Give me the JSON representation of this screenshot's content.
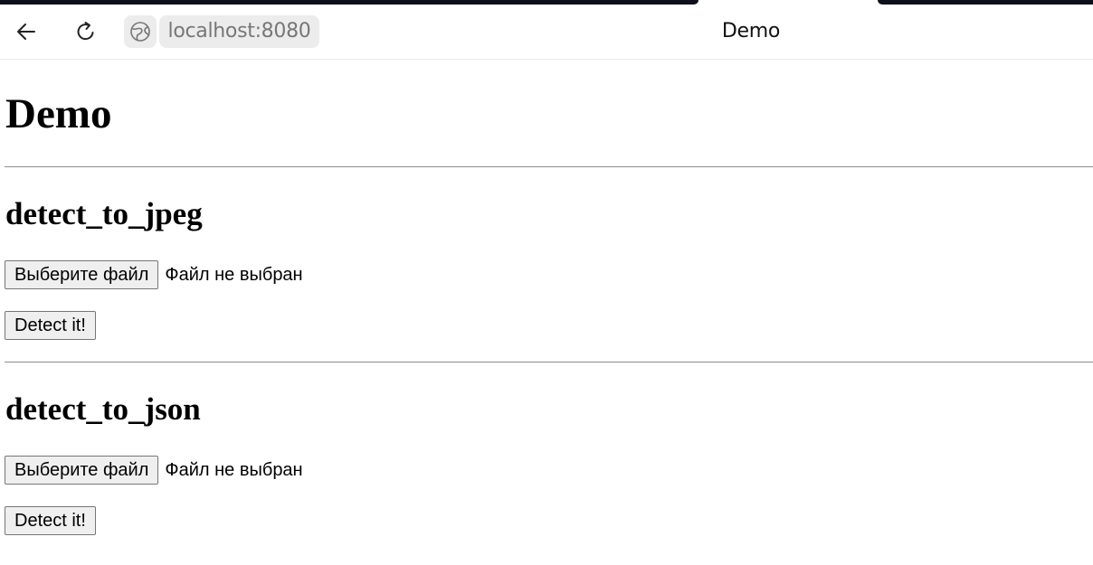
{
  "browser": {
    "url": "localhost:8080",
    "title": "Demo",
    "icons": {
      "back": "arrow-left-icon",
      "reload": "reload-icon",
      "site": "globe-icon"
    }
  },
  "page": {
    "heading": "Demo",
    "sections": [
      {
        "title": "detect_to_jpeg",
        "file_button": "Выберите файл",
        "file_status": "Файл не выбран",
        "submit": "Detect it!"
      },
      {
        "title": "detect_to_json",
        "file_button": "Выберите файл",
        "file_status": "Файл не выбран",
        "submit": "Detect it!"
      }
    ]
  }
}
